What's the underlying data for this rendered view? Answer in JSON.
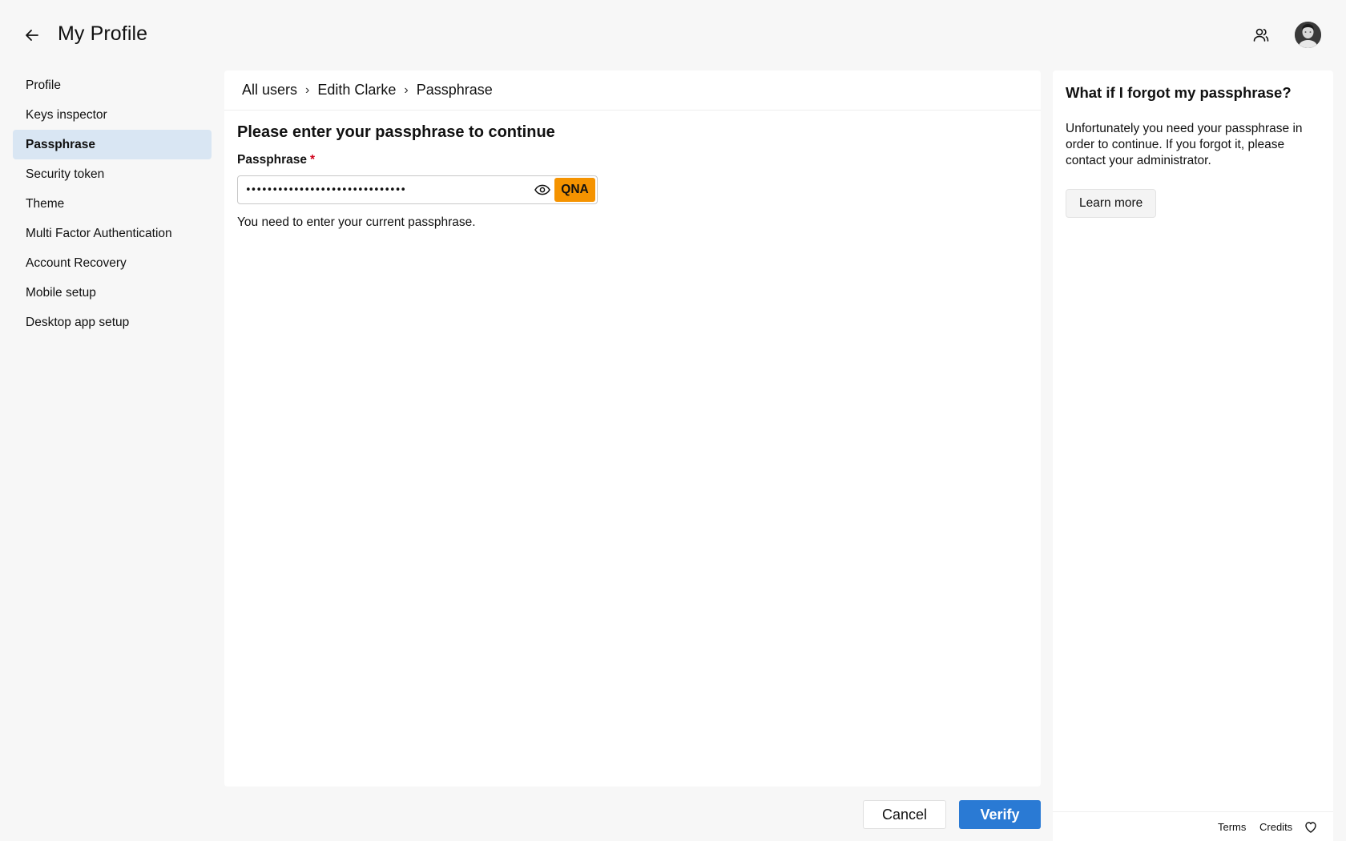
{
  "header": {
    "title": "My Profile",
    "back_icon": "arrow-left-icon",
    "users_icon": "users-icon",
    "avatar": "user-avatar"
  },
  "sidebar": {
    "items": [
      {
        "label": "Profile",
        "active": false
      },
      {
        "label": "Keys inspector",
        "active": false
      },
      {
        "label": "Passphrase",
        "active": true
      },
      {
        "label": "Security token",
        "active": false
      },
      {
        "label": "Theme",
        "active": false
      },
      {
        "label": "Multi Factor Authentication",
        "active": false
      },
      {
        "label": "Account Recovery",
        "active": false
      },
      {
        "label": "Mobile setup",
        "active": false
      },
      {
        "label": "Desktop app setup",
        "active": false
      }
    ]
  },
  "breadcrumb": {
    "items": [
      "All users",
      "Edith Clarke",
      "Passphrase"
    ],
    "separator": "›"
  },
  "form": {
    "title": "Please enter your passphrase to continue",
    "field_label": "Passphrase",
    "required_mark": "*",
    "value": "••••••••••••••••••••••••••••••",
    "badge": "QNA",
    "help": "You need to enter your current passphrase."
  },
  "help_panel": {
    "title": "What if I forgot my passphrase?",
    "text": "Unfortunately you need your passphrase in order to continue. If you forgot it, please contact your administrator.",
    "button": "Learn more"
  },
  "footer": {
    "terms": "Terms",
    "credits": "Credits",
    "heart_icon": "heart-icon"
  },
  "actions": {
    "cancel": "Cancel",
    "verify": "Verify"
  },
  "colors": {
    "accent": "#2a7ad4",
    "active_nav": "#d9e6f3",
    "qna_badge": "#f59300",
    "required": "#d0021b"
  }
}
